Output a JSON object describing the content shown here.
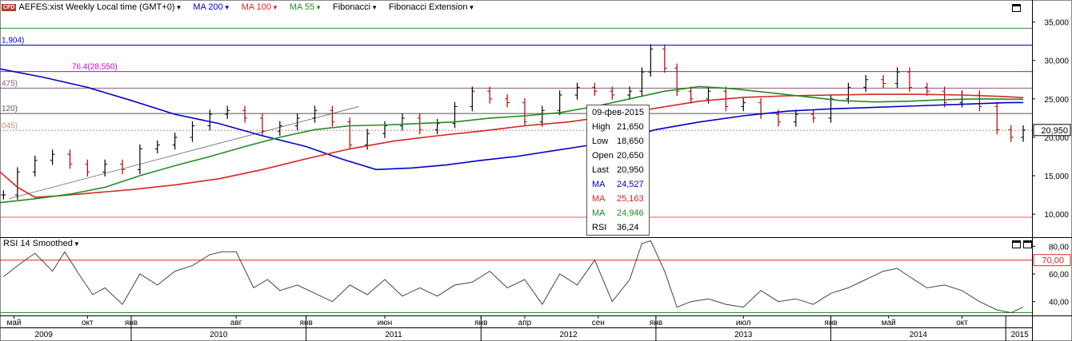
{
  "toolbar": {
    "badge": "CFD",
    "instrument": "AEFES:xist Weekly Local time (GMT+0)",
    "ma200": "MA 200",
    "ma100": "MA 100",
    "ma55": "MA 55",
    "fib": "Fibonacci",
    "fibext": "Fibonacci Extension"
  },
  "rsi_title": "RSI 14 Smoothed",
  "tooltip": {
    "date": "09-фев-2015",
    "high_k": "High",
    "high_v": "21,650",
    "low_k": "Low",
    "low_v": "18,650",
    "open_k": "Open",
    "open_v": "20,650",
    "last_k": "Last",
    "last_v": "20,950",
    "ma1_k": "MA",
    "ma1_v": "24,527",
    "ma2_k": "MA",
    "ma2_v": "25,163",
    "ma3_k": "MA",
    "ma3_v": "24,946",
    "rsi_k": "RSI",
    "rsi_v": "36,24"
  },
  "chart_data": {
    "type": "line",
    "title": "AEFES:xist Weekly Local time (GMT+0)",
    "price_axis": {
      "ylim": [
        7000,
        36000
      ],
      "ticks": [
        10000,
        15000,
        20000,
        25000,
        30000,
        35000
      ],
      "tick_labels": [
        "10,000",
        "15,000",
        "20,000",
        "25,000",
        "30,000",
        "35,000"
      ]
    },
    "rsi_axis": {
      "ylim": [
        30,
        86
      ],
      "ticks": [
        40,
        60,
        80
      ],
      "tick_labels": [
        "40,00",
        "60,00",
        "80,00"
      ]
    },
    "last_price_label": "20,950",
    "rsi_level_label": "70,00",
    "rsi_level": 70,
    "x_range": [
      2009.25,
      2015.15
    ],
    "month_ticks": [
      {
        "t": 2009.33,
        "label": "май"
      },
      {
        "t": 2009.75,
        "label": "окт"
      },
      {
        "t": 2010.0,
        "label": "янв"
      },
      {
        "t": 2010.6,
        "label": "авг"
      },
      {
        "t": 2011.0,
        "label": "янв"
      },
      {
        "t": 2011.45,
        "label": "июн"
      },
      {
        "t": 2012.0,
        "label": "янв"
      },
      {
        "t": 2012.25,
        "label": "апр"
      },
      {
        "t": 2012.67,
        "label": "сен"
      },
      {
        "t": 2013.0,
        "label": "янв"
      },
      {
        "t": 2013.5,
        "label": "июл"
      },
      {
        "t": 2014.0,
        "label": "янв"
      },
      {
        "t": 2014.33,
        "label": "май"
      },
      {
        "t": 2014.75,
        "label": "окт"
      }
    ],
    "year_ticks": [
      {
        "t": 2009.5,
        "label": "2009"
      },
      {
        "t": 2010.5,
        "label": "2010"
      },
      {
        "t": 2011.5,
        "label": "2011"
      },
      {
        "t": 2012.5,
        "label": "2012"
      },
      {
        "t": 2013.5,
        "label": "2013"
      },
      {
        "t": 2014.5,
        "label": "2014"
      },
      {
        "t": 2015.08,
        "label": "2015"
      }
    ],
    "fib_levels": [
      {
        "value": 32000,
        "label": "1,904)",
        "color": "#0000cc"
      },
      {
        "value": 28550,
        "label": "76.4(28,550)",
        "color": "#cc00cc"
      },
      {
        "value": 26400,
        "label": "475)",
        "color": "#8a5a7a"
      },
      {
        "value": 23100,
        "label": "120)",
        "color": "#555555"
      },
      {
        "value": 20900,
        "label": "045)",
        "color": "#cc8877"
      }
    ],
    "hlines": [
      {
        "value": 34200,
        "color": "#2e8b2e"
      },
      {
        "value": 9600,
        "color": "#e06060"
      }
    ],
    "price": {
      "t": [
        2009.27,
        2009.35,
        2009.45,
        2009.55,
        2009.65,
        2009.75,
        2009.85,
        2009.95,
        2010.05,
        2010.15,
        2010.25,
        2010.35,
        2010.45,
        2010.55,
        2010.65,
        2010.75,
        2010.85,
        2010.95,
        2011.05,
        2011.15,
        2011.25,
        2011.35,
        2011.45,
        2011.55,
        2011.65,
        2011.75,
        2011.85,
        2011.95,
        2012.05,
        2012.15,
        2012.25,
        2012.35,
        2012.45,
        2012.55,
        2012.65,
        2012.75,
        2012.85,
        2012.92,
        2012.97,
        2013.05,
        2013.12,
        2013.2,
        2013.3,
        2013.4,
        2013.5,
        2013.6,
        2013.7,
        2013.8,
        2013.9,
        2014.0,
        2014.1,
        2014.2,
        2014.3,
        2014.38,
        2014.45,
        2014.55,
        2014.65,
        2014.75,
        2014.85,
        2014.95,
        2015.03,
        2015.1
      ],
      "close": [
        12500,
        15500,
        17000,
        17800,
        16500,
        15500,
        16500,
        15800,
        18500,
        19000,
        20000,
        21500,
        23000,
        23500,
        22500,
        20800,
        21500,
        22500,
        23500,
        22000,
        19000,
        20500,
        21500,
        22500,
        21000,
        21800,
        24000,
        26000,
        25000,
        24500,
        22000,
        23500,
        25500,
        26500,
        26000,
        25500,
        26000,
        28500,
        31500,
        29000,
        26000,
        25000,
        26000,
        24000,
        24500,
        23000,
        22000,
        23000,
        22500,
        25000,
        26500,
        27500,
        27000,
        28500,
        26500,
        26000,
        24500,
        25500,
        24000,
        21000,
        20000,
        20950
      ]
    },
    "series": [
      {
        "name": "MA 200",
        "color": "#0000cc",
        "t": [
          2009.25,
          2009.5,
          2009.75,
          2010.0,
          2010.25,
          2010.5,
          2010.75,
          2011.0,
          2011.2,
          2011.4,
          2011.6,
          2011.8,
          2012.0,
          2012.2,
          2012.4,
          2012.6,
          2012.8,
          2013.0,
          2013.25,
          2013.5,
          2013.75,
          2014.0,
          2014.25,
          2014.5,
          2014.75,
          2015.0,
          2015.1
        ],
        "values": [
          28900,
          27800,
          26500,
          24800,
          23000,
          21800,
          20200,
          18800,
          17200,
          15800,
          16000,
          16400,
          17000,
          17500,
          18200,
          18900,
          19800,
          21000,
          22000,
          22800,
          23400,
          23700,
          23900,
          24100,
          24300,
          24500,
          24527
        ]
      },
      {
        "name": "MA 100",
        "color": "#dd2222",
        "t": [
          2009.25,
          2009.35,
          2009.45,
          2009.6,
          2009.8,
          2010.0,
          2010.25,
          2010.5,
          2010.75,
          2011.0,
          2011.25,
          2011.5,
          2011.75,
          2012.0,
          2012.25,
          2012.5,
          2012.75,
          2013.0,
          2013.25,
          2013.5,
          2013.75,
          2014.0,
          2014.25,
          2014.5,
          2014.75,
          2015.0,
          2015.1
        ],
        "values": [
          15500,
          13500,
          12200,
          12400,
          12800,
          13200,
          13800,
          14600,
          15800,
          17200,
          18500,
          19500,
          20200,
          20800,
          21500,
          22000,
          22800,
          23800,
          24700,
          25200,
          25400,
          25500,
          25600,
          25600,
          25500,
          25300,
          25163
        ]
      },
      {
        "name": "MA 55",
        "color": "#228b22",
        "t": [
          2009.25,
          2009.45,
          2009.65,
          2009.85,
          2010.05,
          2010.25,
          2010.45,
          2010.65,
          2010.85,
          2011.05,
          2011.25,
          2011.45,
          2011.65,
          2011.85,
          2012.05,
          2012.25,
          2012.45,
          2012.65,
          2012.85,
          2013.05,
          2013.25,
          2013.45,
          2013.65,
          2013.85,
          2014.05,
          2014.25,
          2014.45,
          2014.65,
          2014.85,
          2015.05,
          2015.1
        ],
        "values": [
          11500,
          12000,
          12600,
          13500,
          15000,
          16300,
          17500,
          18800,
          20000,
          21000,
          21500,
          21600,
          21800,
          22000,
          22500,
          22800,
          23200,
          24000,
          25000,
          26000,
          26600,
          26300,
          25800,
          25300,
          24800,
          24600,
          24700,
          24900,
          25000,
          24950,
          24946
        ]
      },
      {
        "name": "RSI 14 Smoothed",
        "color": "#444444",
        "t": [
          2009.27,
          2009.35,
          2009.45,
          2009.55,
          2009.62,
          2009.7,
          2009.78,
          2009.85,
          2009.95,
          2010.05,
          2010.15,
          2010.25,
          2010.35,
          2010.45,
          2010.52,
          2010.6,
          2010.7,
          2010.78,
          2010.85,
          2010.95,
          2011.05,
          2011.15,
          2011.25,
          2011.35,
          2011.45,
          2011.55,
          2011.65,
          2011.75,
          2011.85,
          2011.95,
          2012.05,
          2012.15,
          2012.25,
          2012.35,
          2012.45,
          2012.55,
          2012.65,
          2012.75,
          2012.85,
          2012.92,
          2012.97,
          2013.05,
          2013.12,
          2013.2,
          2013.3,
          2013.4,
          2013.5,
          2013.6,
          2013.7,
          2013.8,
          2013.9,
          2014.0,
          2014.1,
          2014.2,
          2014.3,
          2014.38,
          2014.45,
          2014.55,
          2014.65,
          2014.75,
          2014.85,
          2014.95,
          2015.03,
          2015.1
        ],
        "values": [
          58,
          66,
          75,
          62,
          76,
          60,
          45,
          50,
          38,
          60,
          52,
          62,
          66,
          74,
          76,
          76,
          50,
          56,
          48,
          52,
          46,
          40,
          52,
          45,
          56,
          44,
          50,
          44,
          52,
          54,
          62,
          50,
          56,
          38,
          60,
          52,
          70,
          40,
          56,
          82,
          84,
          62,
          36,
          40,
          42,
          38,
          36,
          48,
          40,
          42,
          38,
          46,
          50,
          56,
          62,
          64,
          58,
          50,
          52,
          48,
          40,
          34,
          32,
          36
        ]
      }
    ]
  }
}
